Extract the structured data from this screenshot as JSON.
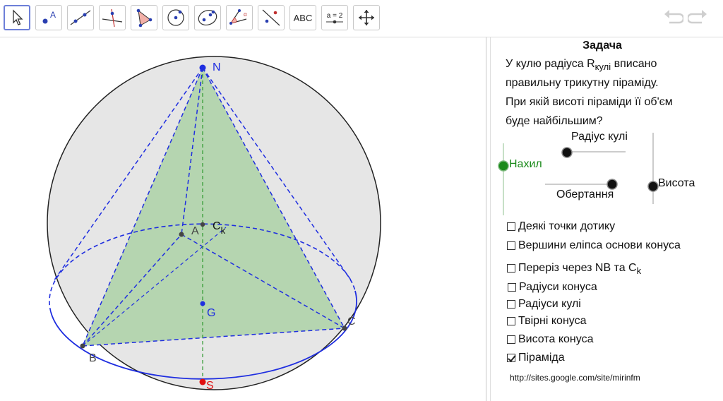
{
  "toolbar": {
    "tools": [
      {
        "name": "move-tool",
        "label": ""
      },
      {
        "name": "point-tool",
        "label": ""
      },
      {
        "name": "line-tool",
        "label": ""
      },
      {
        "name": "perpendicular-line-tool",
        "label": ""
      },
      {
        "name": "polygon-tool",
        "label": ""
      },
      {
        "name": "circle-tool",
        "label": ""
      },
      {
        "name": "ellipse-tool",
        "label": ""
      },
      {
        "name": "angle-tool",
        "label": ""
      },
      {
        "name": "reflect-tool",
        "label": ""
      },
      {
        "name": "text-tool",
        "label": "ABC"
      },
      {
        "name": "slider-tool",
        "label": "a = 2"
      },
      {
        "name": "move-graphics-tool",
        "label": ""
      }
    ]
  },
  "canvas": {
    "points": {
      "N": "N",
      "A": "A",
      "Ck_base": "C",
      "Ck_sub": "k",
      "G": "G",
      "B": "B",
      "C": "C",
      "S": "S"
    },
    "colors": {
      "sphere_fill": "#e6e6e6",
      "pyramid_fill": "#b5d5b0",
      "lines": "#1f2ee0",
      "axis": "#2f9a2f",
      "point_S": "#e01010"
    }
  },
  "panel": {
    "title": "Задача",
    "line1_pre": "У кулю радіуса R",
    "line1_sub": "кулі",
    "line1_post": " вписано",
    "line2": "правильну трикутну піраміду.",
    "line3": "При якій висоті піраміди її об'єм",
    "line4": "буде найбільшим?",
    "sliders": {
      "radius": "Радіус кулі",
      "tilt": "Нахил",
      "rotation": "Обертання",
      "height": "Висота"
    },
    "checkboxes": [
      {
        "label": "Деякі точки дотику",
        "checked": false
      },
      {
        "label": "Вершини еліпса основи конуса",
        "checked": false
      },
      {
        "label": "Переріз через NB та C",
        "sub": "k",
        "checked": false
      },
      {
        "label": "Радіуси конуса",
        "checked": false
      },
      {
        "label": "Радіуси кулі",
        "checked": false
      },
      {
        "label": "Твірні конуса",
        "checked": false
      },
      {
        "label": "Висота конуса",
        "checked": false
      },
      {
        "label": "Піраміда",
        "checked": true
      }
    ],
    "url": "http://sites.google.com/site/mirinfm"
  }
}
